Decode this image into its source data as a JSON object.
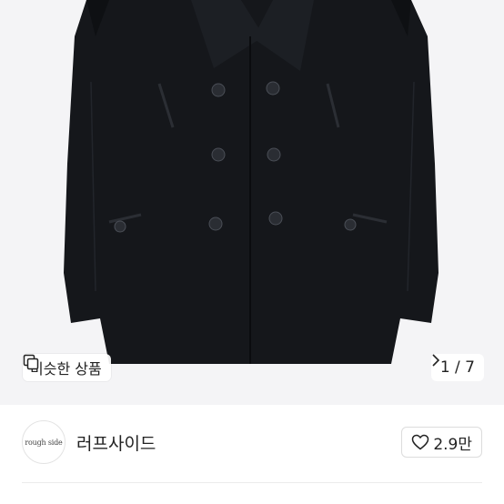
{
  "product_image": {
    "alt": "black double-breasted wool pea coat",
    "colors": {
      "background": "#f4f4f6",
      "coat": "#15171b",
      "buttons": "#2a2d33"
    }
  },
  "overlay": {
    "similar_label": "비슷한 상품",
    "similar_icon": "similar-items-icon",
    "pager_text": "1 / 7",
    "pager_icon": "chevron-right-icon"
  },
  "seller": {
    "avatar_text": "rough side",
    "name": "러프사이드"
  },
  "like": {
    "icon": "heart-outline-icon",
    "count": "2.9만"
  }
}
